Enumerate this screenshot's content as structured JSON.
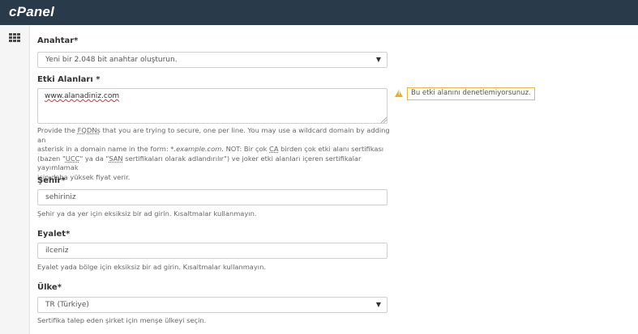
{
  "app": {
    "logo": "cPanel"
  },
  "form": {
    "key": {
      "label": "Anahtar*",
      "value": "Yeni bir 2.048 bit anahtar oluşturun."
    },
    "domains": {
      "label": "Etki Alanları *",
      "value": "www.alanadiniz.com",
      "warning": "Bu etki alanını denetlemiyorsunuz.",
      "help_line1_pre": "Provide the ",
      "help_line1_abbr": "FQDNs",
      "help_line1_post": " that you are trying to secure, one per line. You may use a wildcard domain by adding an",
      "help_line2_pre": "asterisk in a domain name in the form: ",
      "help_line2_em": "*.example.com",
      "help_line2_mid": ". NOT: Bir çok ",
      "help_line2_abbr": "CA",
      "help_line2_post": " birden çok etki alanı sertifikası",
      "help_line3_pre": "(bazen \"",
      "help_line3_abbr1": "UCC",
      "help_line3_mid": "\" ya da \"",
      "help_line3_abbr2": "SAN",
      "help_line3_post": " sertifikaları olarak adlandırılır\") ve joker etki alanları içeren sertifikalar yayımlamak",
      "help_line4": "için daha yüksek fiyat verir."
    },
    "city": {
      "label": "Şehir*",
      "value": "sehiriniz",
      "help": "Şehir ya da yer için eksiksiz bir ad girin. Kısaltmalar kullanmayın."
    },
    "state": {
      "label": "Eyalet*",
      "value": "ilceniz",
      "help": "Eyalet yada bölge için eksiksiz bir ad girin. Kısaltmalar kullanmayın."
    },
    "country": {
      "label": "Ülke*",
      "value": "TR (Türkiye)",
      "help": "Sertifika talep eden şirket için menşe ülkeyi seçin."
    }
  },
  "icons": {
    "apps": "grid-icon",
    "warning": "warning-icon",
    "dropdown": "chevron-down-icon"
  },
  "colors": {
    "topbar": "#293a4a",
    "warning": "#f0ad1c"
  }
}
